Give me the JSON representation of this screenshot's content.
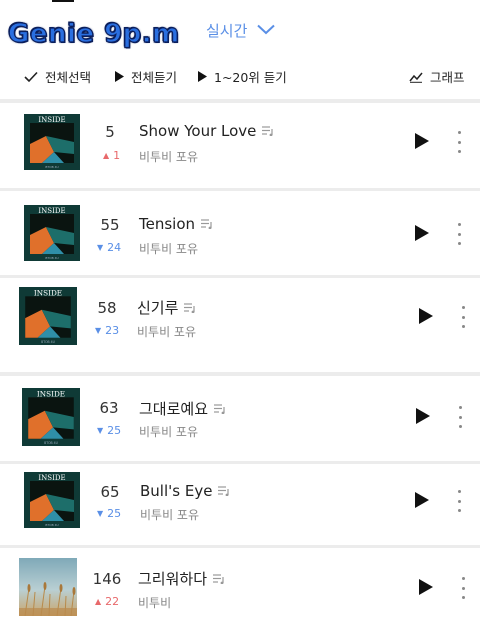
{
  "header": {
    "overlay_title": "Genie 9p.m",
    "period_label": "실시간",
    "period_icon": "chevron-down-icon"
  },
  "toolbar": {
    "select_all": "전체선택",
    "play_all": "전체듣기",
    "play_range": "1~20위 듣기",
    "graph": "그래프"
  },
  "colors": {
    "accent_blue": "#5a8fe6",
    "rank_up": "#e8696b",
    "rank_down": "#5a8fe6",
    "overlay_fill": "#2a6fe0",
    "overlay_outline": "#0b1f5c"
  },
  "songs": [
    {
      "rank": "5",
      "change": "1",
      "direction": "up",
      "title": "Show Your Love",
      "artist": "비투비 포유",
      "cover": "inside"
    },
    {
      "rank": "55",
      "change": "24",
      "direction": "down",
      "title": "Tension",
      "artist": "비투비 포유",
      "cover": "inside"
    },
    {
      "rank": "58",
      "change": "23",
      "direction": "down",
      "title": "신기루",
      "artist": "비투비 포유",
      "cover": "inside"
    },
    {
      "rank": "63",
      "change": "25",
      "direction": "down",
      "title": "그대로예요",
      "artist": "비투비 포유",
      "cover": "inside"
    },
    {
      "rank": "65",
      "change": "25",
      "direction": "down",
      "title": "Bull's Eye",
      "artist": "비투비 포유",
      "cover": "inside"
    },
    {
      "rank": "146",
      "change": "22",
      "direction": "up",
      "title": "그리워하다",
      "artist": "비투비",
      "cover": "field"
    }
  ],
  "cover_text": {
    "inside": "INSIDE",
    "inside_small": "BTOB 4U"
  },
  "icons": {
    "check": "check-icon",
    "play": "play-icon",
    "graph": "chart-line-icon",
    "lyrics": "lyrics-icon",
    "more": "more-vertical-icon",
    "up": "▲",
    "down": "▼"
  }
}
